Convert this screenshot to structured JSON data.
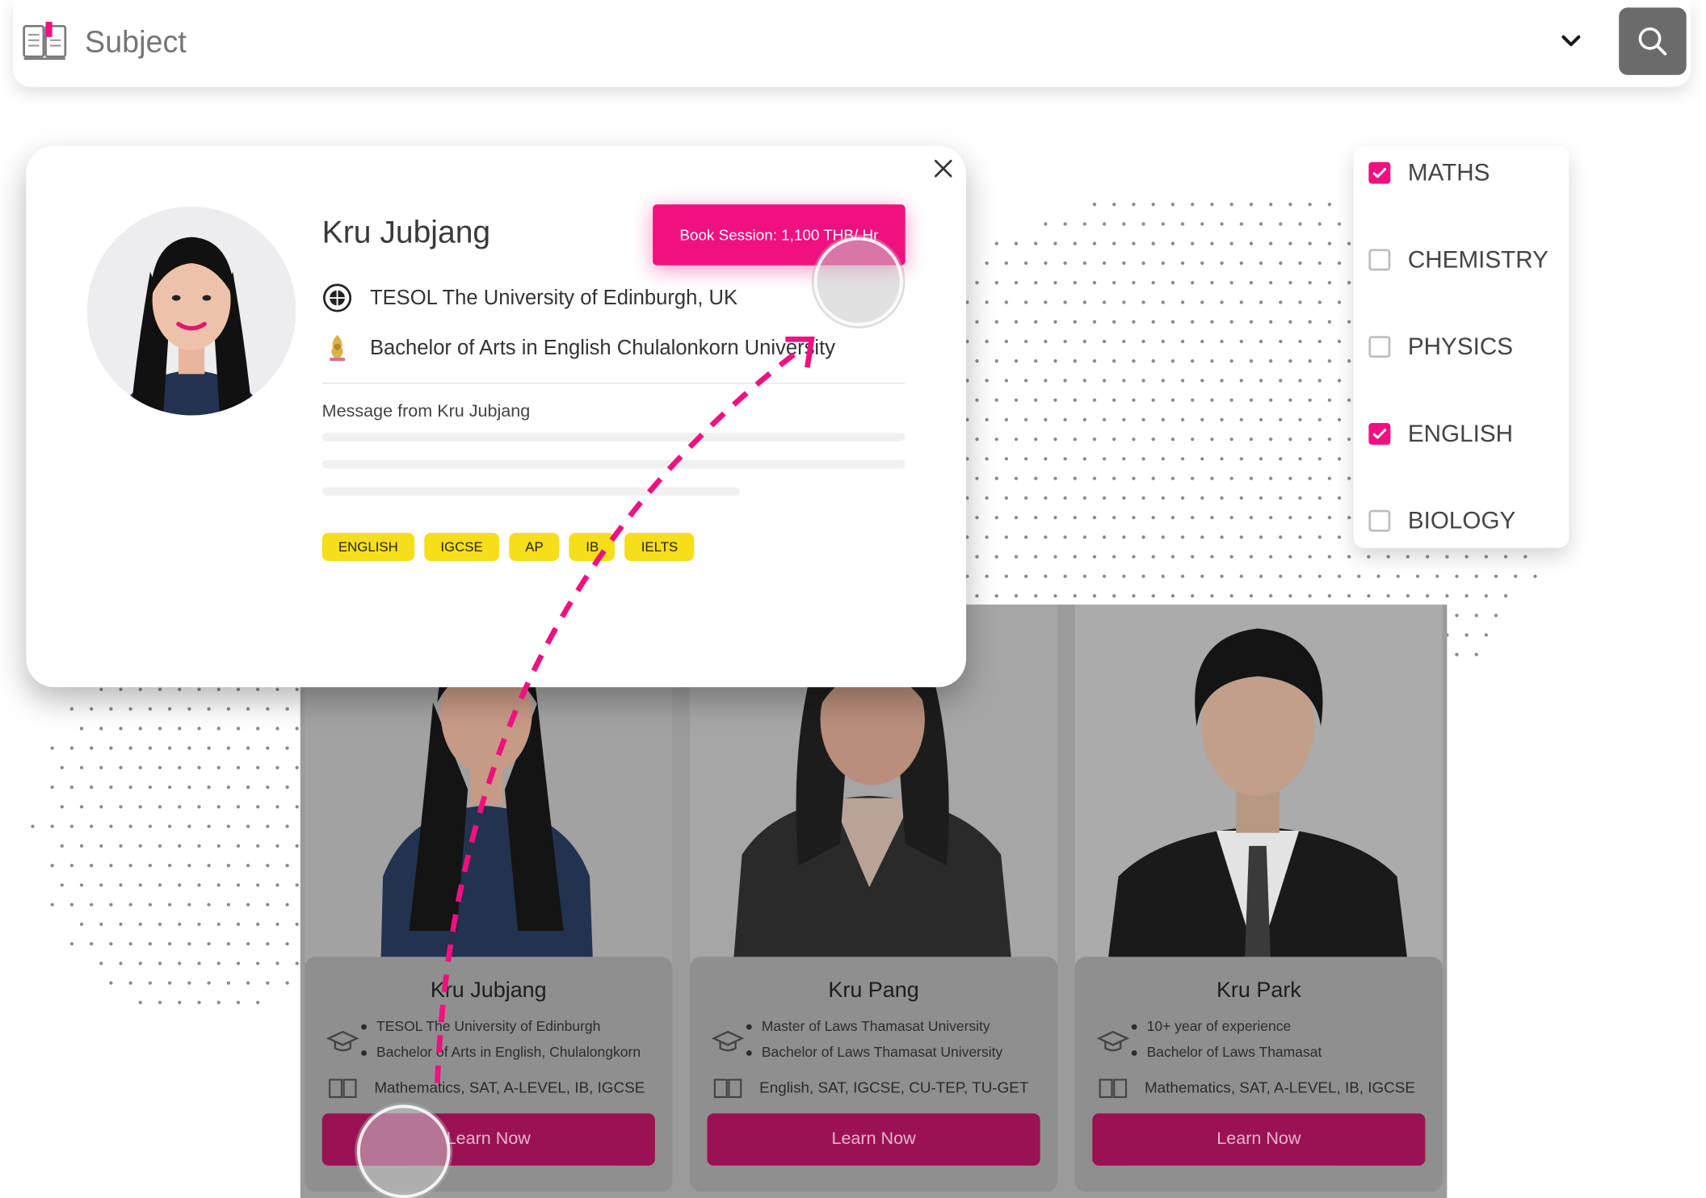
{
  "search": {
    "placeholder": "Subject",
    "button_icon": "search-icon",
    "dropdown_icon": "chevron-down-icon"
  },
  "popup": {
    "name": "Kru Jubjang",
    "book_button": "Book Session: 1,100 THB/ Hr",
    "qualifications": [
      {
        "text": "TESOL The University of Edinburgh, UK",
        "icon": "university-crest-icon"
      },
      {
        "text": "Bachelor of Arts in English Chulalonkorn University",
        "icon": "university-emblem-icon"
      }
    ],
    "message_label": "Message from Kru Jubjang",
    "tags": [
      "ENGLISH",
      "IGCSE",
      "AP",
      "IB",
      "IELTS"
    ]
  },
  "subject_filter": {
    "options": [
      {
        "label": "MATHS",
        "checked": true
      },
      {
        "label": "CHEMISTRY",
        "checked": false
      },
      {
        "label": "PHYSICS",
        "checked": false
      },
      {
        "label": "ENGLISH",
        "checked": true
      },
      {
        "label": "BIOLOGY",
        "checked": false
      }
    ]
  },
  "tutors": [
    {
      "name": "Kru Jubjang",
      "bullets": [
        "TESOL The University of Edinburgh",
        "Bachelor of Arts in English, Chulalongkorn"
      ],
      "subjects": "Mathematics, SAT, A-LEVEL, IB, IGCSE",
      "cta": "Learn Now"
    },
    {
      "name": "Kru Pang",
      "bullets": [
        "Master of Laws Thamasat University",
        "Bachelor of Laws Thamasat University"
      ],
      "subjects": "English, SAT, IGCSE, CU-TEP, TU-GET",
      "cta": "Learn Now"
    },
    {
      "name": "Kru Park",
      "bullets": [
        "10+ year of experience",
        "Bachelor of Laws Thamasat"
      ],
      "subjects": "Mathematics, SAT, A-LEVEL, IB, IGCSE",
      "cta": "Learn Now"
    }
  ],
  "colors": {
    "accent": "#f0107f",
    "cta_dim": "#9b1254",
    "tag_yellow": "#f7de1a",
    "overlay_grey": "#9b9b9b"
  }
}
